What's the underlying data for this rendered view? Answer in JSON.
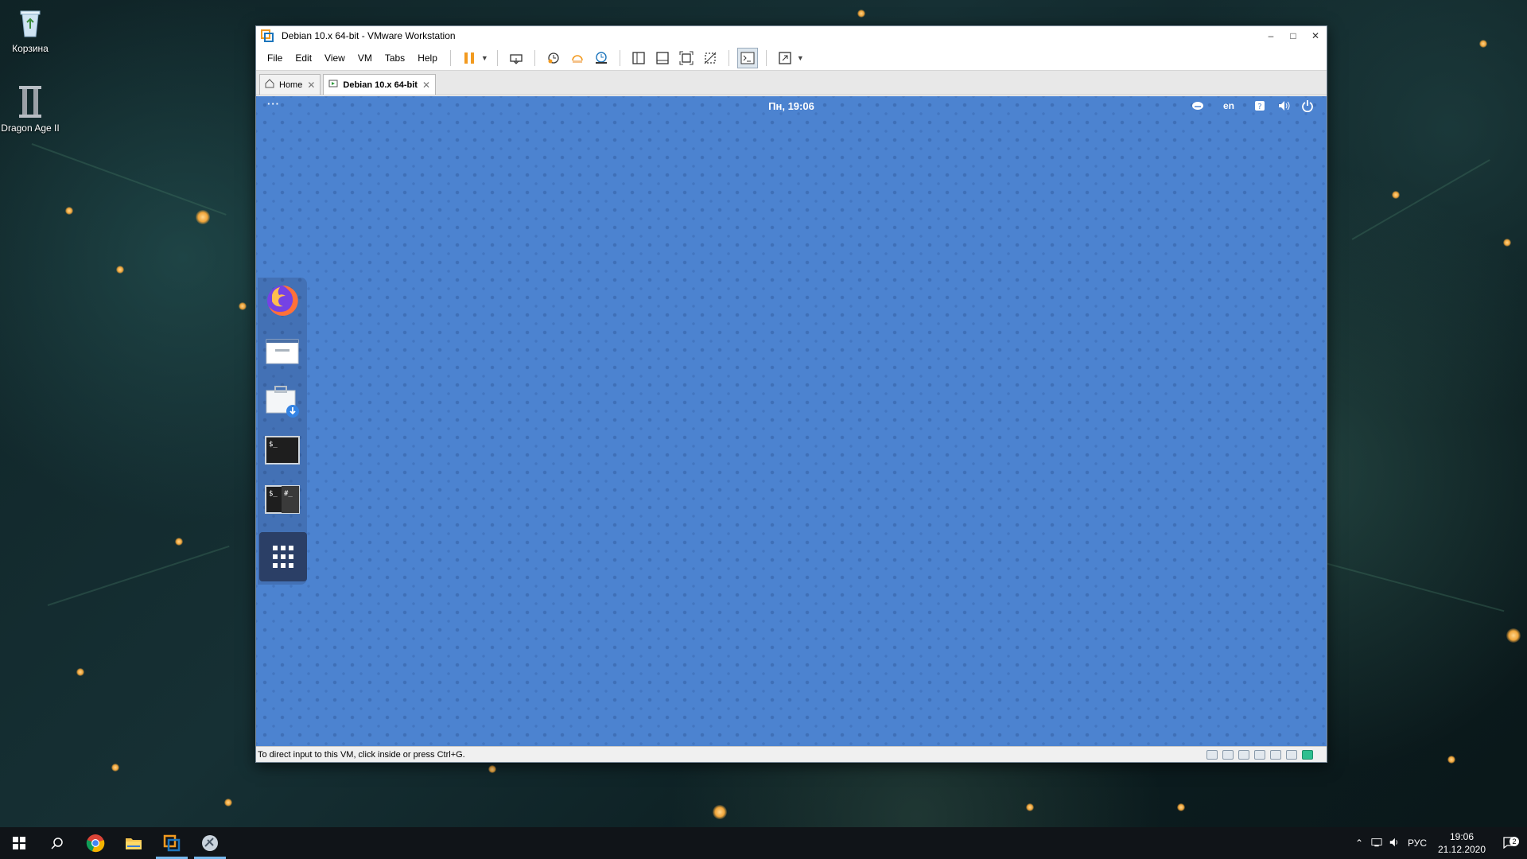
{
  "desktop": {
    "icons": [
      {
        "label": "Корзина"
      },
      {
        "label": "Dragon Age II"
      }
    ]
  },
  "vmware": {
    "title": "Debian 10.x 64-bit - VMware Workstation",
    "window_controls": {
      "minimize": "–",
      "maximize": "□",
      "close": "✕"
    },
    "menu": [
      "File",
      "Edit",
      "View",
      "VM",
      "Tabs",
      "Help"
    ],
    "toolbar_icons": [
      "pause-icon",
      "send-keys-icon",
      "snapshot-icon",
      "revert-snapshot-icon",
      "snapshot-manager-icon",
      "library-icon",
      "console-view-icon",
      "fullscreen-icon",
      "unity-icon",
      "terminal-icon",
      "stretch-icon"
    ],
    "tabs": [
      {
        "label": "Home",
        "active": false
      },
      {
        "label": "Debian 10.x 64-bit",
        "active": true
      }
    ],
    "status_hint": "To direct input to this VM, click inside or press Ctrl+G."
  },
  "guest": {
    "activities": "···",
    "clock": "Пн, 19:06",
    "lang": "en",
    "background_color": "#4c83d0",
    "dock": [
      "firefox-icon",
      "mail-icon",
      "software-icon",
      "terminal-icon",
      "root-terminal-icon",
      "show-apps-icon"
    ]
  },
  "taskbar": {
    "apps": [
      "chrome-icon",
      "file-explorer-icon",
      "vmware-icon",
      "game-launcher-icon"
    ],
    "lang": "РУС",
    "time": "19:06",
    "date": "21.12.2020",
    "notifications": "2"
  }
}
